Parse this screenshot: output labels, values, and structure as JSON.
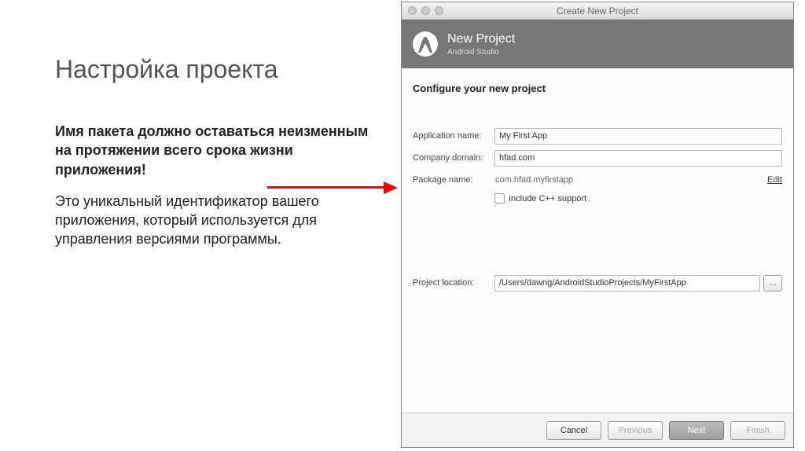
{
  "slide": {
    "title": "Настройка проекта",
    "bold_paragraph": "Имя пакета должно оставаться неизменным на протяжении всего срока жизни приложения!",
    "paragraph": "Это уникальный идентификатор вашего приложения, который используется для управления версиями программы."
  },
  "dialog": {
    "window_title": "Create New Project",
    "header_title": "New Project",
    "header_subtitle": "Android Studio",
    "subheading": "Configure your new project",
    "fields": {
      "app_name_label": "Application name:",
      "app_name_value": "My First App",
      "company_label": "Company domain:",
      "company_value": "hfad.com",
      "package_label": "Package name:",
      "package_value": "com.hfad.myfirstapp",
      "edit_link": "Edit",
      "cpp_checkbox_label": "Include C++ support",
      "location_label": "Project location:",
      "location_value": "/Users/dawng/AndroidStudioProjects/MyFirstApp",
      "browse_label": "…"
    },
    "buttons": {
      "cancel": "Cancel",
      "previous": "Previous",
      "next": "Next",
      "finish": "Finish"
    }
  }
}
